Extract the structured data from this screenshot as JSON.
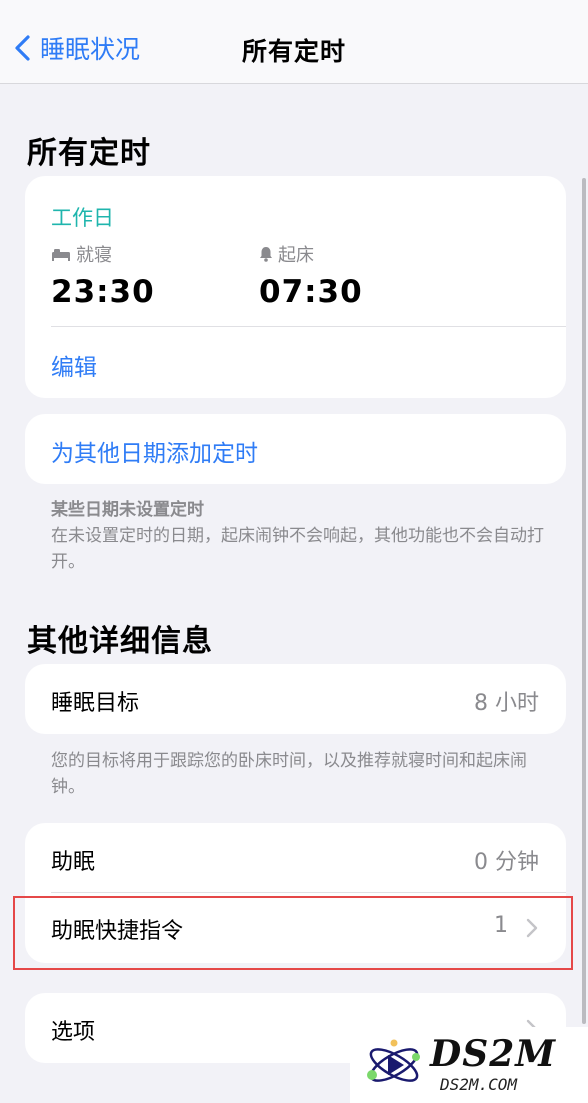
{
  "nav": {
    "back_label": "睡眠状况",
    "title": "所有定时"
  },
  "schedules": {
    "title": "所有定时",
    "card": {
      "day_label": "工作日",
      "bedtime_label": "就寝",
      "bedtime_value": "23:30",
      "wake_label": "起床",
      "wake_value": "07:30",
      "edit_label": "编辑"
    },
    "add_label": "为其他日期添加定时",
    "note_title": "某些日期未设置定时",
    "note_body": "在未设置定时的日期，起床闹钟不会响起，其他功能也不会自动打开。"
  },
  "details": {
    "title": "其他详细信息",
    "sleep_goal_label": "睡眠目标",
    "sleep_goal_value": "8 小时",
    "sleep_goal_note": "您的目标将用于跟踪您的卧床时间，以及推荐就寝时间和起床闹钟。",
    "wind_down_label": "助眠",
    "wind_down_value": "0 分钟",
    "shortcuts_label": "助眠快捷指令",
    "shortcuts_value": "1",
    "options_label": "选项"
  },
  "watermark": {
    "brand": "DS2M",
    "domain": "DS2M.COM"
  },
  "colors": {
    "accent_blue": "#2f7cf6",
    "accent_teal": "#1fb5ad",
    "highlight_red": "#e54848"
  },
  "icons": [
    "chevron-left-icon",
    "bed-icon",
    "bell-icon",
    "chevron-right-icon"
  ]
}
